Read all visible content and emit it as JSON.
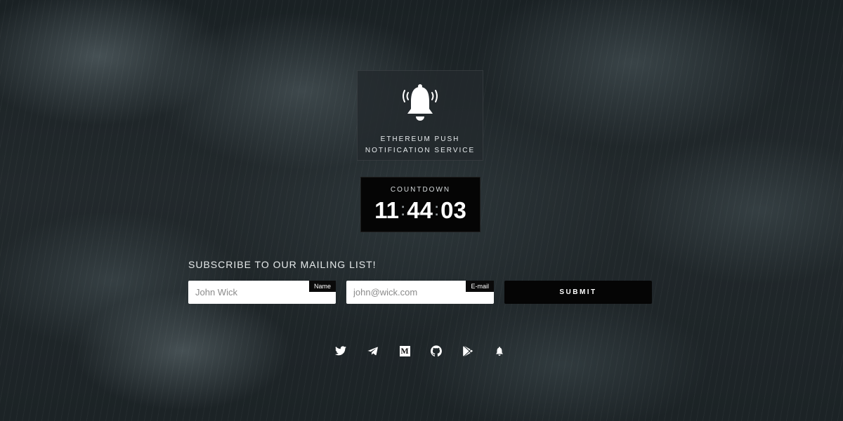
{
  "brand": {
    "title_line1": "ETHEREUM PUSH",
    "title_line2": "NOTIFICATION SERVICE",
    "icon": "bell-icon"
  },
  "countdown": {
    "label": "COUNTDOWN",
    "hours": "11",
    "minutes": "44",
    "seconds": "03",
    "separator": ":"
  },
  "subscribe": {
    "heading": "SUBSCRIBE TO OUR MAILING LIST!",
    "name_field": {
      "placeholder": "John Wick",
      "value": "",
      "tag": "Name"
    },
    "email_field": {
      "placeholder": "john@wick.com",
      "value": "",
      "tag": "E-mail"
    },
    "submit_label": "SUBMIT"
  },
  "socials": [
    {
      "icon": "twitter-icon"
    },
    {
      "icon": "telegram-icon"
    },
    {
      "icon": "medium-icon",
      "glyph": "M"
    },
    {
      "icon": "github-icon"
    },
    {
      "icon": "google-play-icon"
    },
    {
      "icon": "bell-icon"
    }
  ],
  "colors": {
    "background": "#22292c",
    "card_dark": "#050505",
    "text": "#ffffff"
  }
}
